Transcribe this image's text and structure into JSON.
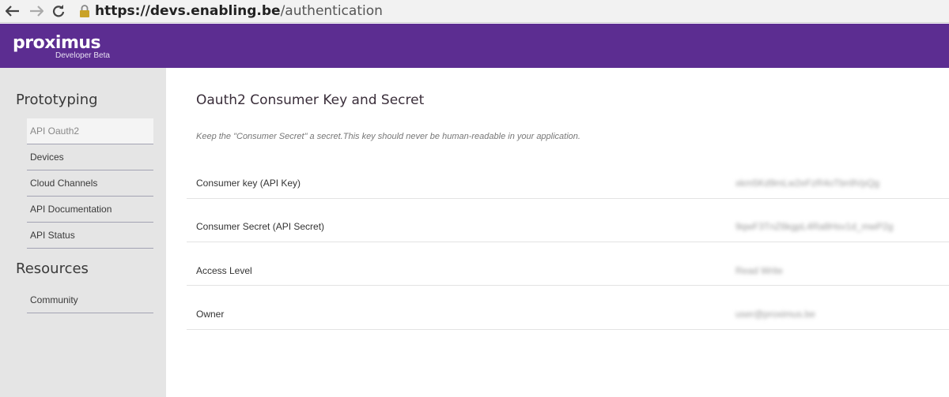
{
  "browser": {
    "url_host": "https://devs.enabling.be",
    "url_path": "/authentication"
  },
  "header": {
    "logo": "proximus",
    "subtitle": "Developer Beta",
    "color": "#5c2d91"
  },
  "sidebar": {
    "sections": [
      {
        "title": "Prototyping"
      },
      {
        "title": "Resources"
      }
    ],
    "items": [
      {
        "label": "API Oauth2"
      },
      {
        "label": "Devices"
      },
      {
        "label": "Cloud Channels"
      },
      {
        "label": "API Documentation"
      },
      {
        "label": "API Status"
      },
      {
        "label": "Community"
      }
    ]
  },
  "main": {
    "title": "Oauth2 Consumer Key and Secret",
    "note": "Keep the \"Consumer Secret\" a secret.This key should never be human-readable in your application.",
    "rows": [
      {
        "label": "Consumer key (API Key)",
        "value": "xkm5Kd9mLw2eFzR4oTbn9VpQg"
      },
      {
        "label": "Consumer Secret (API Secret)",
        "value": "9qwF3TnZ6kgpL4Ra8Hsv1d_mwP2g"
      },
      {
        "label": "Access Level",
        "value": "Read Write"
      },
      {
        "label": "Owner",
        "value": "user@proximus.be"
      }
    ]
  }
}
